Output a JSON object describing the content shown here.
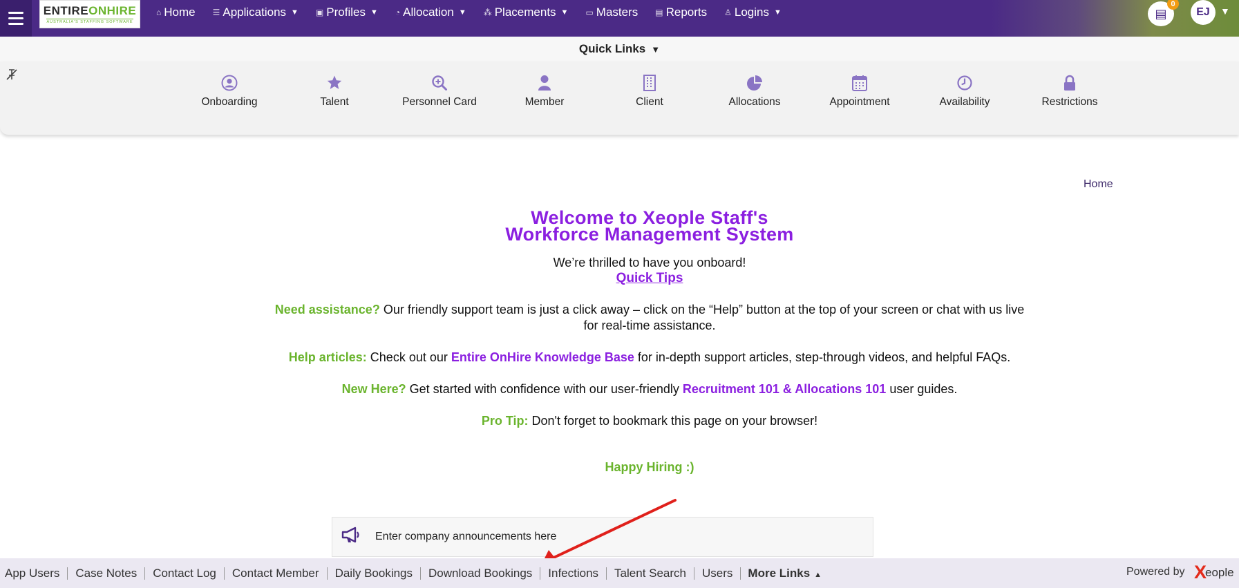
{
  "logo": {
    "part1": "ENTIRE",
    "part2": "ONHIRE",
    "tagline": "AUSTRALIA'S STAFFING SOFTWARE"
  },
  "nav": {
    "items": [
      {
        "label": "Home",
        "icon": "home-icon",
        "dropdown": false
      },
      {
        "label": "Applications",
        "icon": "list-icon",
        "dropdown": true
      },
      {
        "label": "Profiles",
        "icon": "id-card-icon",
        "dropdown": true
      },
      {
        "label": "Allocation",
        "icon": "pie-icon",
        "dropdown": true
      },
      {
        "label": "Placements",
        "icon": "hierarchy-icon",
        "dropdown": true
      },
      {
        "label": "Masters",
        "icon": "folder-icon",
        "dropdown": false
      },
      {
        "label": "Reports",
        "icon": "document-icon",
        "dropdown": false
      },
      {
        "label": "Logins",
        "icon": "user-icon",
        "dropdown": true
      }
    ],
    "notification_count": "0",
    "avatar_initials": "EJ"
  },
  "quick_links": {
    "title": "Quick Links",
    "items": [
      {
        "label": "Onboarding",
        "icon": "user-circle-icon"
      },
      {
        "label": "Talent",
        "icon": "star-icon"
      },
      {
        "label": "Personnel Card",
        "icon": "search-plus-icon"
      },
      {
        "label": "Member",
        "icon": "user-icon"
      },
      {
        "label": "Client",
        "icon": "building-icon"
      },
      {
        "label": "Allocations",
        "icon": "pie-chart-icon"
      },
      {
        "label": "Appointment",
        "icon": "calendar-icon"
      },
      {
        "label": "Availability",
        "icon": "clock-icon"
      },
      {
        "label": "Restrictions",
        "icon": "lock-icon"
      }
    ]
  },
  "breadcrumb": "Home",
  "welcome": {
    "title_line1": "Welcome to Xeople Staff's",
    "title_line2": "Workforce Management System",
    "thrilled": "We’re thrilled to have you onboard!",
    "quick_tips": "Quick Tips",
    "assist_label": "Need assistance?",
    "assist_text": " Our friendly support team is just a click away – click on the “Help” button at the top of your screen or chat with us live for real-time assistance.",
    "help_label": "Help articles:",
    "help_text1": " Check out our ",
    "help_link": "Entire OnHire Knowledge Base",
    "help_text2": " for in-depth support articles, step-through videos, and helpful FAQs.",
    "new_label": "New Here?",
    "new_text1": " Get started with confidence with our user-friendly ",
    "new_link1": "Recruitment 101",
    "new_amp": " & ",
    "new_link2": "Allocations 101",
    "new_text2": " user guides.",
    "pro_label": "Pro Tip:",
    "pro_text": " Don't forget to bookmark this page on your browser!",
    "happy": "Happy Hiring :)"
  },
  "announcement": {
    "text": "Enter company announcements here"
  },
  "footer": {
    "links": [
      "App Users",
      "Case Notes",
      "Contact Log",
      "Contact Member",
      "Daily Bookings",
      "Download Bookings",
      "Infections",
      "Talent Search",
      "Users"
    ],
    "more": "More Links",
    "powered_by": "Powered by",
    "brand_x": "X",
    "brand_rest": "eople"
  },
  "colors": {
    "nav_bg": "#4b2a86",
    "accent_purple": "#8b1fe0",
    "accent_green": "#6ab42d",
    "icon_purple": "#8a74c4",
    "arrow_red": "#e0201b"
  }
}
